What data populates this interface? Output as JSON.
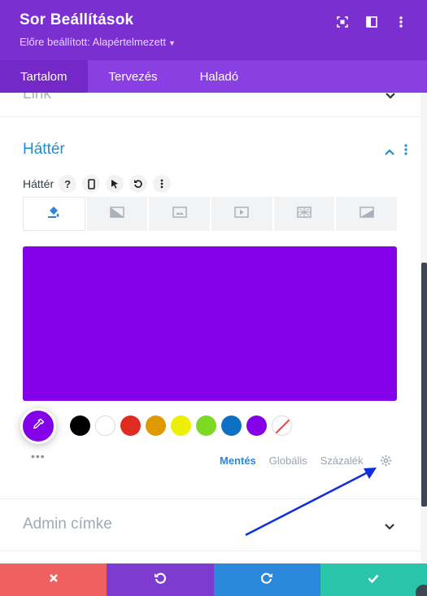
{
  "header": {
    "title": "Sor Beállítások",
    "preset_label": "Előre beállított: Alapértelmezett",
    "icons": [
      "focus-icon",
      "sidebar-icon",
      "more-vertical-icon"
    ],
    "bg_color": "#7b2fd0"
  },
  "tabs": [
    {
      "label": "Tartalom",
      "active": true
    },
    {
      "label": "Tervezés",
      "active": false
    },
    {
      "label": "Haladó",
      "active": false
    }
  ],
  "sections": {
    "link": {
      "title": "Link"
    },
    "background": {
      "title": "Háttér",
      "field_label": "Háttér",
      "field_icons": [
        "help-icon",
        "mobile-icon",
        "cursor-icon",
        "reset-icon",
        "more-vertical-icon"
      ],
      "type_tabs": [
        "color-fill-icon",
        "gradient-icon",
        "image-icon",
        "video-icon",
        "pattern-icon",
        "mask-icon"
      ],
      "preview_color": "#8300e9",
      "picker_color": "#8300e9",
      "swatches": [
        "#000000",
        "#ffffff",
        "#e02b20",
        "#e09900",
        "#edf000",
        "#7cda24",
        "#0c71c3",
        "#8300e9",
        "none"
      ],
      "palette_tabs": [
        {
          "label": "Mentés",
          "active": true
        },
        {
          "label": "Globális",
          "active": false
        },
        {
          "label": "Százalék",
          "active": false
        }
      ]
    },
    "admin": {
      "title": "Admin címke"
    }
  },
  "footer": {
    "buttons": [
      "cancel-icon",
      "undo-icon",
      "redo-icon",
      "save-icon"
    ]
  }
}
